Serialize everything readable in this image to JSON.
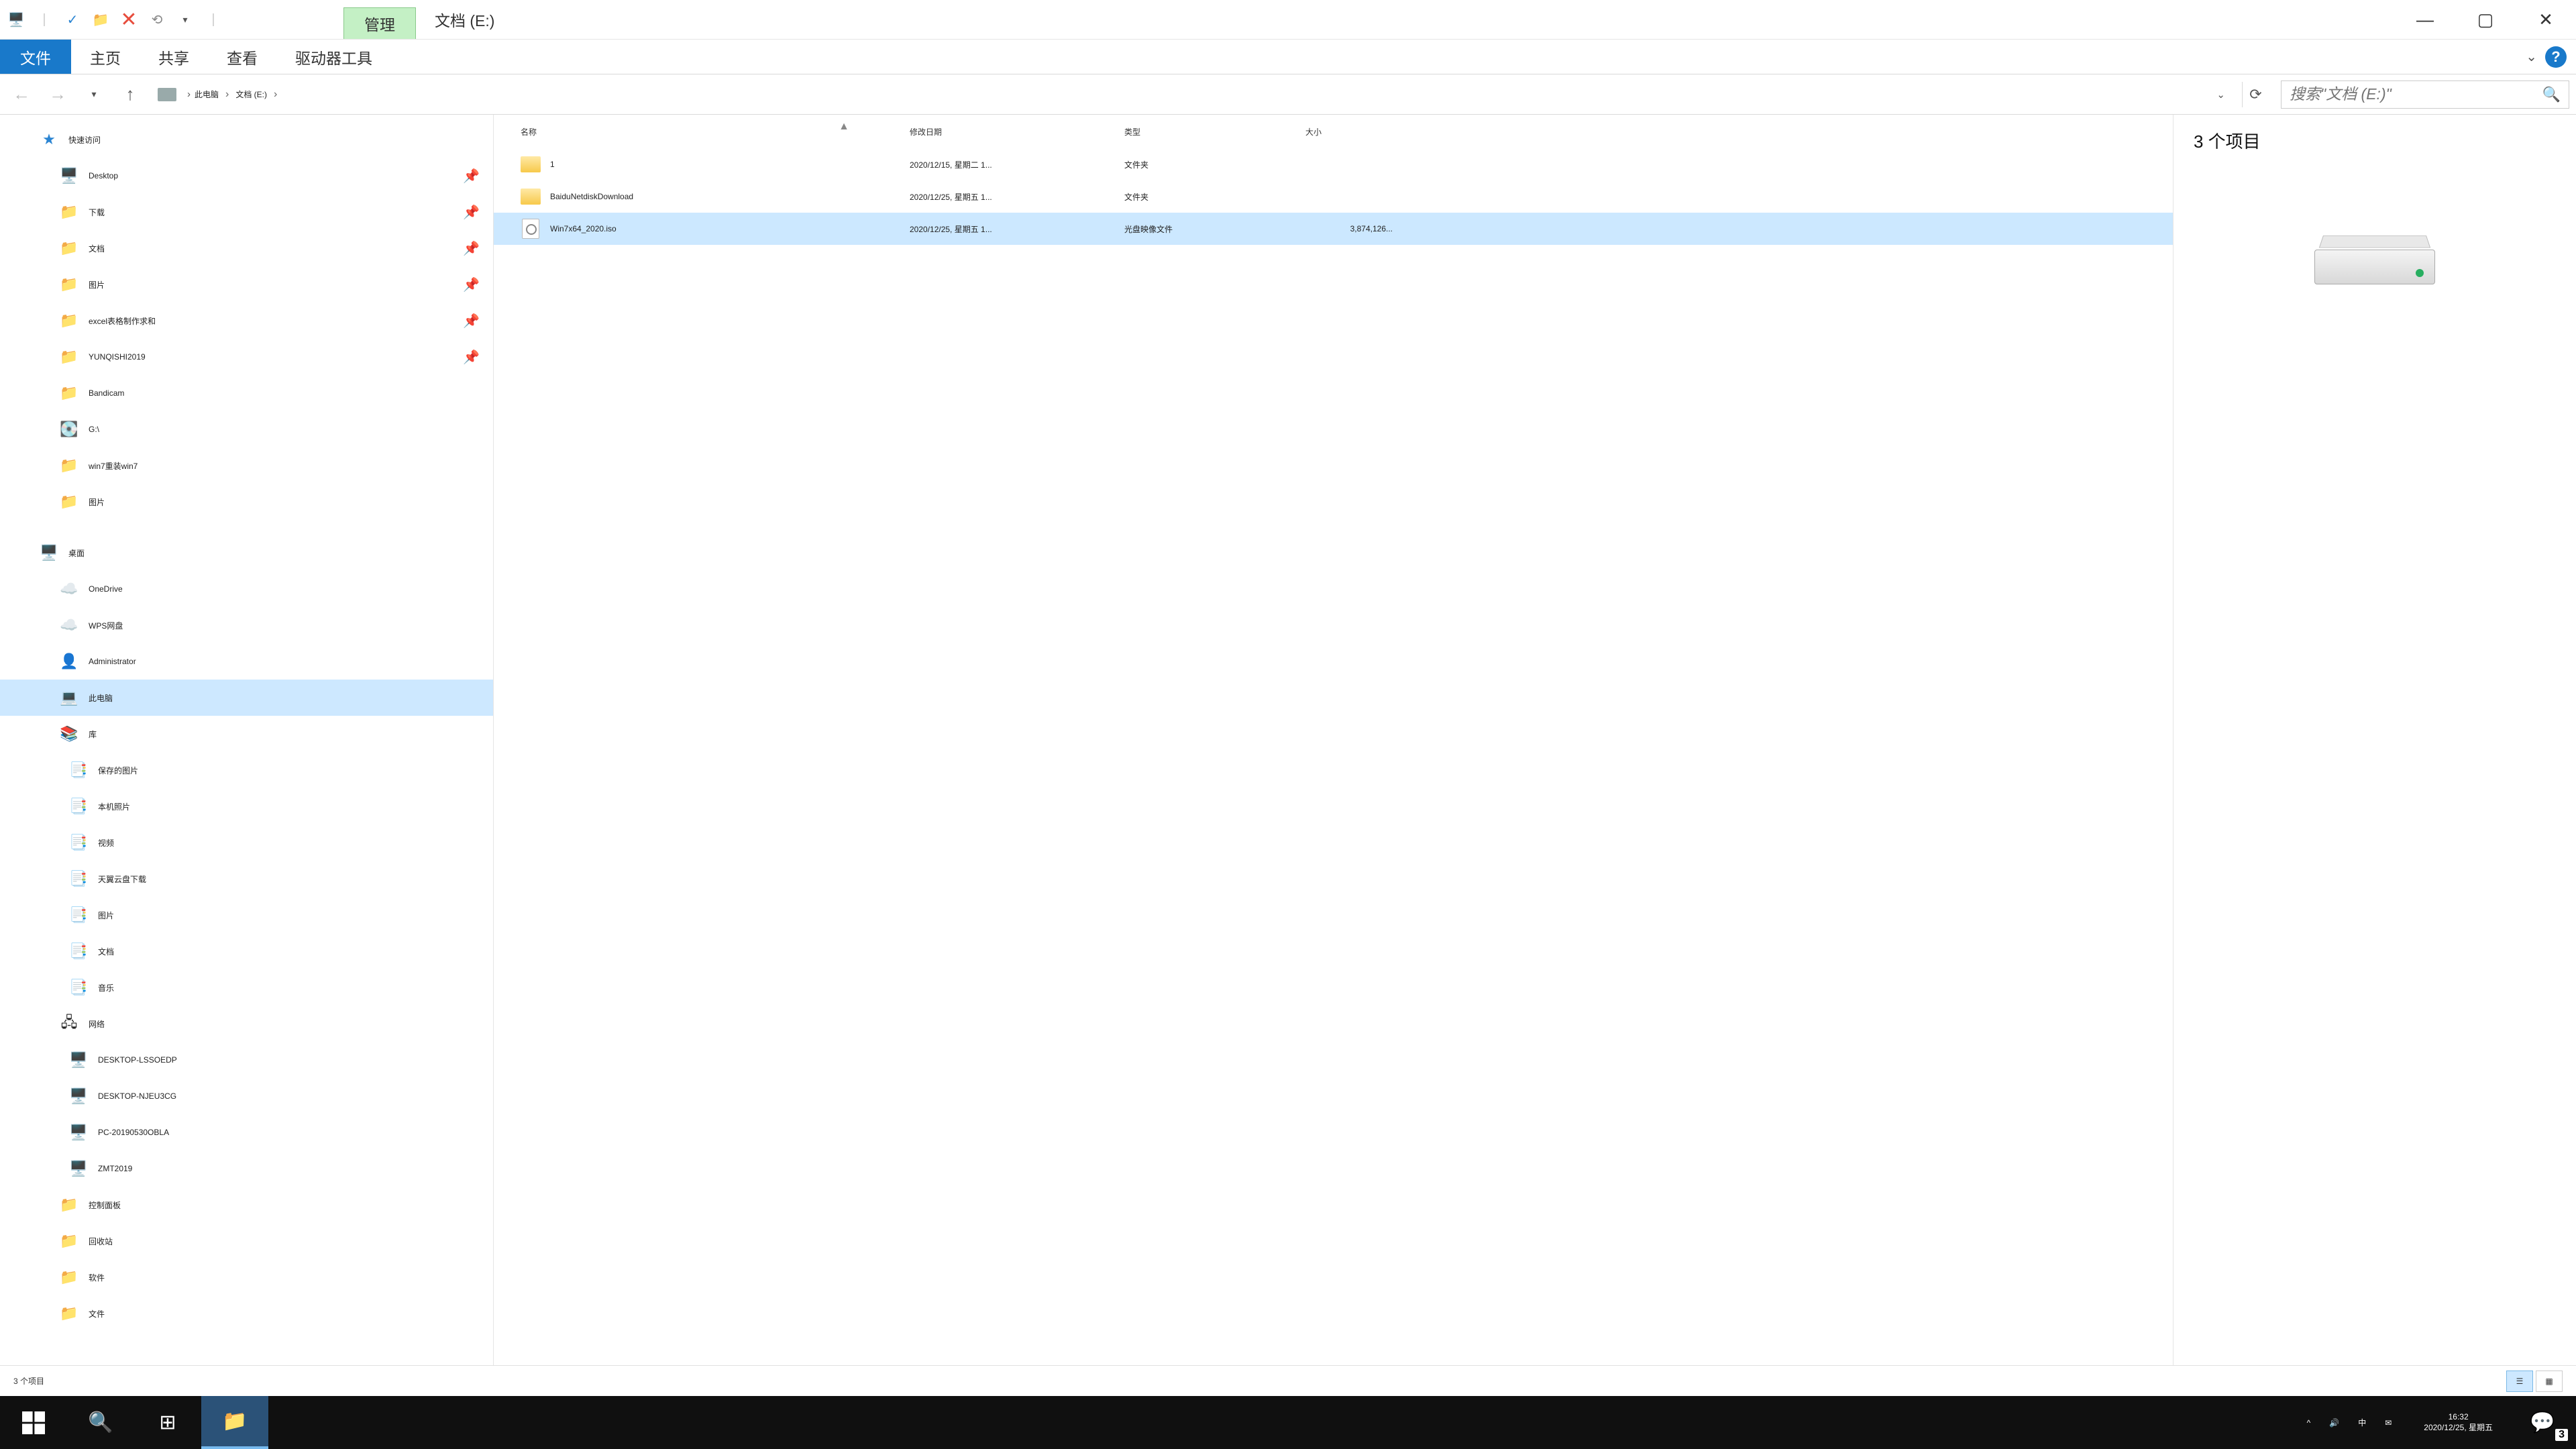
{
  "titlebar": {
    "context_tab": "管理",
    "title": "文档 (E:)"
  },
  "ribbon": {
    "file": "文件",
    "tabs": [
      "主页",
      "共享",
      "查看",
      "驱动器工具"
    ]
  },
  "nav": {
    "breadcrumb": [
      "此电脑",
      "文档 (E:)"
    ],
    "search_placeholder": "搜索\"文档 (E:)\""
  },
  "tree": {
    "quick_access": "快速访问",
    "quick_items": [
      {
        "label": "Desktop",
        "pin": true,
        "icon": "desktop"
      },
      {
        "label": "下载",
        "pin": true,
        "icon": "folder"
      },
      {
        "label": "文档",
        "pin": true,
        "icon": "folder"
      },
      {
        "label": "图片",
        "pin": true,
        "icon": "folder"
      },
      {
        "label": "excel表格制作求和",
        "pin": true,
        "icon": "folder"
      },
      {
        "label": "YUNQISHI2019",
        "pin": true,
        "icon": "folder"
      },
      {
        "label": "Bandicam",
        "pin": false,
        "icon": "folder"
      },
      {
        "label": "G:\\",
        "pin": false,
        "icon": "drive"
      },
      {
        "label": "win7重装win7",
        "pin": false,
        "icon": "folder"
      },
      {
        "label": "图片",
        "pin": false,
        "icon": "folder"
      }
    ],
    "desktop": "桌面",
    "desktop_items": [
      {
        "label": "OneDrive",
        "icon": "cloud"
      },
      {
        "label": "WPS网盘",
        "icon": "cloud"
      },
      {
        "label": "Administrator",
        "icon": "user"
      },
      {
        "label": "此电脑",
        "icon": "pc",
        "selected": true
      },
      {
        "label": "库",
        "icon": "lib"
      }
    ],
    "library_items": [
      {
        "label": "保存的图片"
      },
      {
        "label": "本机照片"
      },
      {
        "label": "视频"
      },
      {
        "label": "天翼云盘下载"
      },
      {
        "label": "图片"
      },
      {
        "label": "文档"
      },
      {
        "label": "音乐"
      }
    ],
    "network": "网络",
    "network_items": [
      "DESKTOP-LSSOEDP",
      "DESKTOP-NJEU3CG",
      "PC-20190530OBLA",
      "ZMT2019"
    ],
    "extra": [
      "控制面板",
      "回收站",
      "软件",
      "文件"
    ]
  },
  "columns": {
    "name": "名称",
    "date": "修改日期",
    "type": "类型",
    "size": "大小"
  },
  "files": [
    {
      "name": "1",
      "date": "2020/12/15, 星期二 1...",
      "type": "文件夹",
      "size": "",
      "icon": "folder"
    },
    {
      "name": "BaiduNetdiskDownload",
      "date": "2020/12/25, 星期五 1...",
      "type": "文件夹",
      "size": "",
      "icon": "folder"
    },
    {
      "name": "Win7x64_2020.iso",
      "date": "2020/12/25, 星期五 1...",
      "type": "光盘映像文件",
      "size": "3,874,126...",
      "icon": "iso",
      "selected": true
    }
  ],
  "preview": {
    "count": "3 个项目"
  },
  "status": {
    "text": "3 个项目"
  },
  "taskbar": {
    "time": "16:32",
    "date": "2020/12/25, 星期五",
    "ime": "中",
    "notif_count": "3"
  }
}
